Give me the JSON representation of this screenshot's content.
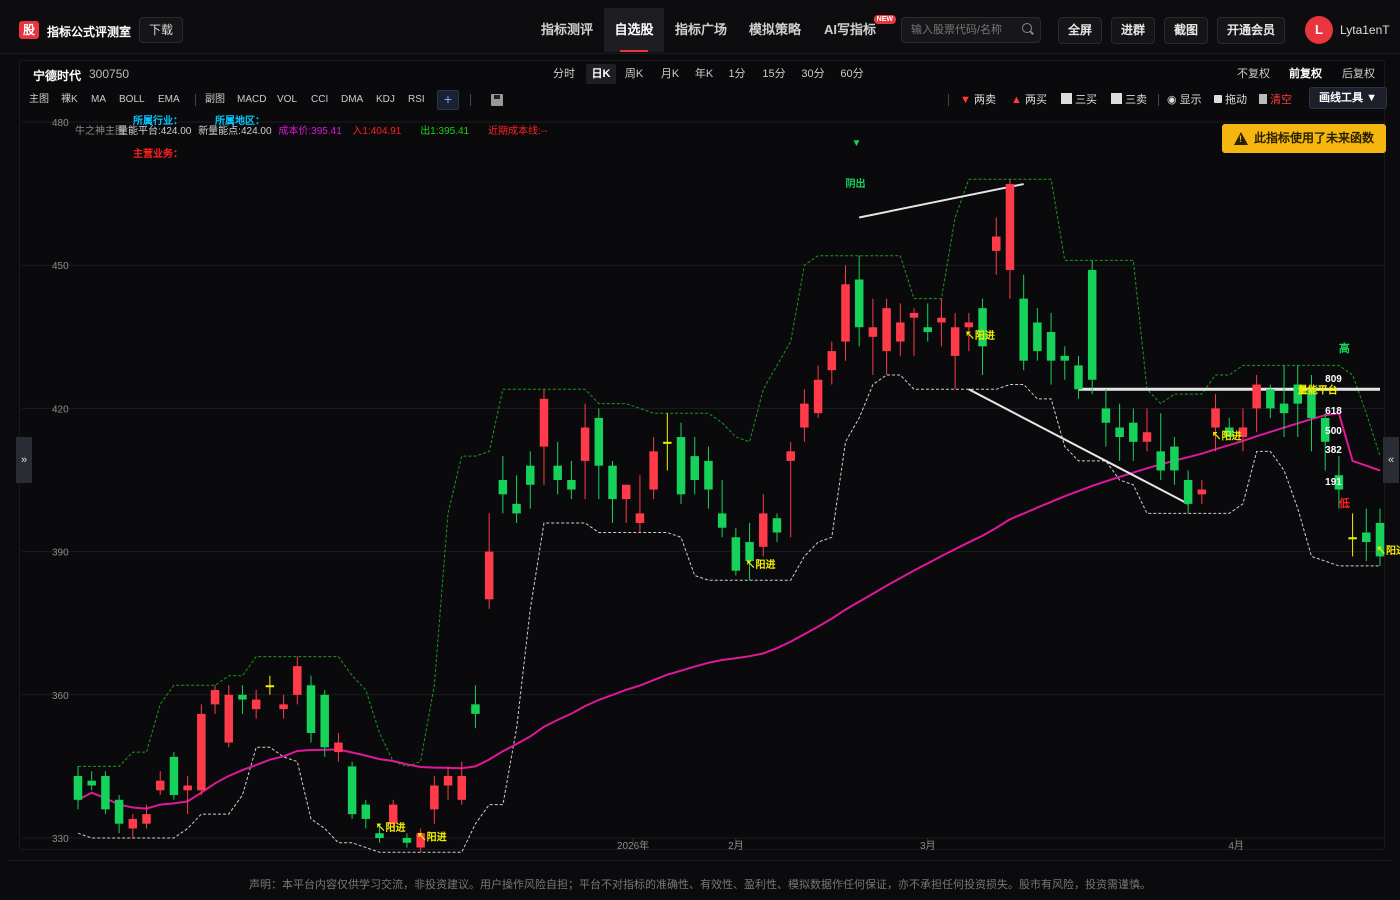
{
  "header": {
    "logo_char": "股",
    "brand": "指标公式评测室",
    "download": "下载",
    "nav": [
      {
        "label": "指标测评",
        "active": false
      },
      {
        "label": "自选股",
        "active": true
      },
      {
        "label": "指标广场",
        "active": false
      },
      {
        "label": "模拟策略",
        "active": false
      },
      {
        "label": "AI写指标",
        "active": false,
        "badge": "NEW"
      }
    ],
    "search_placeholder": "输入股票代码/名称",
    "buttons": [
      "全屏",
      "进群",
      "截图",
      "开通会员"
    ],
    "avatar_letter": "L",
    "username": "Lyta1enT"
  },
  "stock": {
    "name": "宁德时代",
    "code": "300750"
  },
  "periods": [
    {
      "label": "分时",
      "active": false
    },
    {
      "label": "日K",
      "active": true
    },
    {
      "label": "周K",
      "active": false
    },
    {
      "label": "月K",
      "active": false
    },
    {
      "label": "年K",
      "active": false
    },
    {
      "label": "1分",
      "active": false
    },
    {
      "label": "15分",
      "active": false
    },
    {
      "label": "30分",
      "active": false
    },
    {
      "label": "60分",
      "active": false
    }
  ],
  "adjust": [
    {
      "label": "不复权",
      "active": false
    },
    {
      "label": "前复权",
      "active": true
    },
    {
      "label": "后复权",
      "active": false
    }
  ],
  "indicators_main": [
    "主图",
    "裸K",
    "MA",
    "BOLL",
    "EMA"
  ],
  "indicators_sub": [
    "副图",
    "MACD",
    "VOL",
    "CCI",
    "DMA",
    "KDJ",
    "RSI"
  ],
  "plus_label": "+",
  "tools": [
    {
      "label": "两卖",
      "icon": "down-triangle-icon",
      "color": "#ff3a3a"
    },
    {
      "label": "两买",
      "icon": "up-triangle-icon",
      "color": "#ff3a3a"
    },
    {
      "label": "三买",
      "icon": "trend-line-icon",
      "color": "#dddddd"
    },
    {
      "label": "三卖",
      "icon": "trend-line-icon",
      "color": "#dddddd"
    },
    {
      "label": "显示",
      "icon": "eye-icon",
      "color": "#dddddd"
    },
    {
      "label": "拖动",
      "icon": "lock-icon",
      "color": "#dddddd"
    },
    {
      "label": "清空",
      "icon": "trash-icon",
      "color": "#ff3a3a"
    }
  ],
  "draw_tool": "画线工具 ▼",
  "warning": "此指标使用了未来函数",
  "side_left": "»",
  "side_right": "«",
  "legend": {
    "industry": "所属行业：",
    "region": "所属地区：",
    "main_business": "主营业务：",
    "items": [
      {
        "text": "牛之神主图",
        "color": "#8a8a8a"
      },
      {
        "text": "量能平台:424.00",
        "color": "#d0d0d0"
      },
      {
        "text": "新量能点:424.00",
        "color": "#d0d0d0"
      },
      {
        "text": "成本价:395.41",
        "color": "#d916d9"
      },
      {
        "text": "入1:404.91",
        "color": "#ff2020"
      },
      {
        "text": "出1:395.41",
        "color": "#16d116"
      },
      {
        "text": "近期成本线:--",
        "color": "#ff2020"
      }
    ]
  },
  "chart_data": {
    "type": "candlestick",
    "y_ticks": [
      480,
      450,
      420,
      390,
      360,
      330
    ],
    "ylim": [
      330,
      480
    ],
    "x_labels": [
      "2026年",
      "2月",
      "3月",
      "4月"
    ],
    "candles": [
      {
        "o": 343,
        "c": 338,
        "h": 345,
        "l": 336
      },
      {
        "o": 342,
        "c": 341,
        "h": 344,
        "l": 340
      },
      {
        "o": 343,
        "c": 336,
        "h": 344,
        "l": 335
      },
      {
        "o": 338,
        "c": 333,
        "h": 339,
        "l": 331
      },
      {
        "o": 332,
        "c": 334,
        "h": 335,
        "l": 330
      },
      {
        "o": 333,
        "c": 335,
        "h": 337,
        "l": 332
      },
      {
        "o": 340,
        "c": 342,
        "h": 344,
        "l": 339
      },
      {
        "o": 347,
        "c": 339,
        "h": 348,
        "l": 338
      },
      {
        "o": 340,
        "c": 341,
        "h": 343,
        "l": 335
      },
      {
        "o": 340,
        "c": 356,
        "h": 358,
        "l": 339
      },
      {
        "o": 358,
        "c": 361,
        "h": 362,
        "l": 356
      },
      {
        "o": 350,
        "c": 360,
        "h": 362,
        "l": 349
      },
      {
        "o": 360,
        "c": 359,
        "h": 362,
        "l": 356
      },
      {
        "o": 357,
        "c": 359,
        "h": 361,
        "l": 355
      },
      {
        "o": 362,
        "c": 362,
        "h": 364,
        "l": 360
      },
      {
        "o": 357,
        "c": 358,
        "h": 360,
        "l": 355
      },
      {
        "o": 360,
        "c": 366,
        "h": 368,
        "l": 358
      },
      {
        "o": 362,
        "c": 352,
        "h": 364,
        "l": 350
      },
      {
        "o": 360,
        "c": 349,
        "h": 361,
        "l": 347
      },
      {
        "o": 348,
        "c": 350,
        "h": 352,
        "l": 346
      },
      {
        "o": 345,
        "c": 335,
        "h": 346,
        "l": 334
      },
      {
        "o": 337,
        "c": 334,
        "h": 338,
        "l": 332
      },
      {
        "o": 331,
        "c": 330,
        "h": 333,
        "l": 329
      },
      {
        "o": 333,
        "c": 337,
        "h": 338,
        "l": 332
      },
      {
        "o": 330,
        "c": 329,
        "h": 331,
        "l": 328
      },
      {
        "o": 328,
        "c": 331,
        "h": 332,
        "l": 327
      },
      {
        "o": 336,
        "c": 341,
        "h": 343,
        "l": 333
      },
      {
        "o": 341,
        "c": 343,
        "h": 345,
        "l": 338
      },
      {
        "o": 338,
        "c": 343,
        "h": 346,
        "l": 337
      },
      {
        "o": 358,
        "c": 356,
        "h": 362,
        "l": 353
      },
      {
        "o": 380,
        "c": 390,
        "h": 398,
        "l": 378
      },
      {
        "o": 405,
        "c": 402,
        "h": 410,
        "l": 398
      },
      {
        "o": 400,
        "c": 398,
        "h": 406,
        "l": 396
      },
      {
        "o": 408,
        "c": 404,
        "h": 411,
        "l": 399
      },
      {
        "o": 412,
        "c": 422,
        "h": 424,
        "l": 404
      },
      {
        "o": 408,
        "c": 405,
        "h": 413,
        "l": 402
      },
      {
        "o": 405,
        "c": 403,
        "h": 409,
        "l": 401
      },
      {
        "o": 409,
        "c": 416,
        "h": 421,
        "l": 401
      },
      {
        "o": 418,
        "c": 408,
        "h": 420,
        "l": 401
      },
      {
        "o": 408,
        "c": 401,
        "h": 409,
        "l": 396
      },
      {
        "o": 401,
        "c": 404,
        "h": 404,
        "l": 396
      },
      {
        "o": 396,
        "c": 398,
        "h": 406,
        "l": 394
      },
      {
        "o": 403,
        "c": 411,
        "h": 414,
        "l": 401
      },
      {
        "o": 413,
        "c": 413,
        "h": 419,
        "l": 407
      },
      {
        "o": 414,
        "c": 402,
        "h": 417,
        "l": 400
      },
      {
        "o": 410,
        "c": 405,
        "h": 414,
        "l": 402
      },
      {
        "o": 409,
        "c": 403,
        "h": 412,
        "l": 399
      },
      {
        "o": 398,
        "c": 395,
        "h": 405,
        "l": 393
      },
      {
        "o": 393,
        "c": 386,
        "h": 395,
        "l": 385
      },
      {
        "o": 392,
        "c": 388,
        "h": 396,
        "l": 384
      },
      {
        "o": 391,
        "c": 398,
        "h": 402,
        "l": 389
      },
      {
        "o": 397,
        "c": 394,
        "h": 398,
        "l": 392
      },
      {
        "o": 409,
        "c": 411,
        "h": 413,
        "l": 393
      },
      {
        "o": 416,
        "c": 421,
        "h": 424,
        "l": 413
      },
      {
        "o": 419,
        "c": 426,
        "h": 429,
        "l": 418
      },
      {
        "o": 428,
        "c": 432,
        "h": 434,
        "l": 425
      },
      {
        "o": 434,
        "c": 446,
        "h": 450,
        "l": 430
      },
      {
        "o": 447,
        "c": 437,
        "h": 452,
        "l": 433
      },
      {
        "o": 435,
        "c": 437,
        "h": 443,
        "l": 427
      },
      {
        "o": 432,
        "c": 441,
        "h": 443,
        "l": 427
      },
      {
        "o": 434,
        "c": 438,
        "h": 442,
        "l": 431
      },
      {
        "o": 439,
        "c": 440,
        "h": 441,
        "l": 431
      },
      {
        "o": 437,
        "c": 436,
        "h": 442,
        "l": 434
      },
      {
        "o": 438,
        "c": 439,
        "h": 443,
        "l": 433
      },
      {
        "o": 431,
        "c": 437,
        "h": 440,
        "l": 424
      },
      {
        "o": 437,
        "c": 438,
        "h": 440,
        "l": 432
      },
      {
        "o": 441,
        "c": 433,
        "h": 443,
        "l": 427
      },
      {
        "o": 453,
        "c": 456,
        "h": 460,
        "l": 448
      },
      {
        "o": 449,
        "c": 467,
        "h": 468,
        "l": 443
      },
      {
        "o": 443,
        "c": 430,
        "h": 448,
        "l": 428
      },
      {
        "o": 438,
        "c": 432,
        "h": 441,
        "l": 430
      },
      {
        "o": 436,
        "c": 430,
        "h": 440,
        "l": 425
      },
      {
        "o": 431,
        "c": 430,
        "h": 433,
        "l": 426
      },
      {
        "o": 429,
        "c": 424,
        "h": 431,
        "l": 422
      },
      {
        "o": 449,
        "c": 426,
        "h": 451,
        "l": 423
      },
      {
        "o": 420,
        "c": 417,
        "h": 424,
        "l": 412
      },
      {
        "o": 416,
        "c": 414,
        "h": 421,
        "l": 409
      },
      {
        "o": 417,
        "c": 413,
        "h": 420,
        "l": 409
      },
      {
        "o": 413,
        "c": 415,
        "h": 420,
        "l": 411
      },
      {
        "o": 411,
        "c": 407,
        "h": 419,
        "l": 405
      },
      {
        "o": 412,
        "c": 407,
        "h": 414,
        "l": 404
      },
      {
        "o": 405,
        "c": 400,
        "h": 407,
        "l": 398
      },
      {
        "o": 402,
        "c": 403,
        "h": 405,
        "l": 400
      },
      {
        "o": 416,
        "c": 420,
        "h": 423,
        "l": 411
      },
      {
        "o": 416,
        "c": 414,
        "h": 418,
        "l": 414
      },
      {
        "o": 414,
        "c": 416,
        "h": 420,
        "l": 411
      },
      {
        "o": 420,
        "c": 425,
        "h": 427,
        "l": 415
      },
      {
        "o": 424,
        "c": 420,
        "h": 425,
        "l": 418
      },
      {
        "o": 421,
        "c": 419,
        "h": 429,
        "l": 414
      },
      {
        "o": 425,
        "c": 421,
        "h": 429,
        "l": 414
      },
      {
        "o": 424,
        "c": 418,
        "h": 427,
        "l": 411
      },
      {
        "o": 418,
        "c": 413,
        "h": 419,
        "l": 407
      },
      {
        "o": 406,
        "c": 403,
        "h": 410,
        "l": 399
      },
      {
        "o": 393,
        "c": 393,
        "h": 398,
        "l": 389
      },
      {
        "o": 394,
        "c": 392,
        "h": 399,
        "l": 388
      },
      {
        "o": 396,
        "c": 389,
        "h": 399,
        "l": 387
      }
    ]
  },
  "annotations": {
    "sell": "阴出",
    "buy": "阳进",
    "high": "高",
    "low": "低",
    "platform": "量能平台",
    "fib": [
      "809",
      "618",
      "500",
      "382",
      "191"
    ]
  },
  "disclaimer": "声明：本平台内容仅供学习交流，非投资建议。用户操作风险自担；平台不对指标的准确性、有效性、盈利性、模拟数据作任何保证，亦不承担任何投资损失。股市有风险，投资需谨慎。",
  "colors": {
    "up": "#ff3b4a",
    "down": "#16d15a",
    "doji": "#f5f000",
    "cost": "#e0189a",
    "upper": "#1a9a1a",
    "lower": "#cfcfcf"
  }
}
